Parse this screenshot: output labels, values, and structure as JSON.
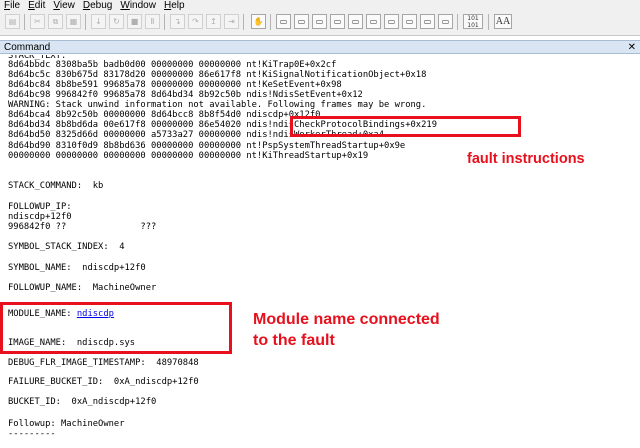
{
  "menu": [
    {
      "name": "file",
      "label": "File"
    },
    {
      "name": "edit",
      "label": "Edit"
    },
    {
      "name": "view",
      "label": "View"
    },
    {
      "name": "debug",
      "label": "Debug"
    },
    {
      "name": "window",
      "label": "Window"
    },
    {
      "name": "help",
      "label": "Help"
    }
  ],
  "toolbar_labels": {
    "hex": "101",
    "hex2": "101",
    "font": "AA"
  },
  "window_title": "Command",
  "lines": [
    {
      "t": "STACK_TEXT:"
    },
    {
      "t": "8d64bbdc 8308ba5b badb0d00 00000000 00000000 nt!KiTrap0E+0x2cf"
    },
    {
      "t": "8d64bc5c 830b675d 83178d20 00000000 86e617f8 nt!KiSignalNotificationObject+0x18"
    },
    {
      "t": "8d64bc84 8b8be591 99685a78 00000000 00000000 nt!KeSetEvent+0x98"
    },
    {
      "t": "8d64bc98 996842f0 99685a78 8d64bd34 8b92c50b ndis!NdisSetEvent+0x12"
    },
    {
      "t": "WARNING: Stack unwind information not available. Following frames may be wrong."
    },
    {
      "t": "8d64bca4 8b92c50b 00000000 8d64bcc8 8b8f54d0 ndiscdp+0x12f0"
    },
    {
      "t": "8d64bd34 8b8bd6da 00e617f8 00000000 86e54020 ndis!ndisCheckProtocolBindings+0x219"
    },
    {
      "t": "8d64bd50 8325d66d 00000000 a5733a27 00000000 ndis!ndisWorkerThread+0xa4"
    },
    {
      "t": "8d64bd90 8310f0d9 8b8bd636 00000000 00000000 nt!PspSystemThreadStartup+0x9e"
    },
    {
      "t": "00000000 00000000 00000000 00000000 00000000 nt!KiThreadStartup+0x19"
    },
    {
      "t": ""
    },
    {
      "t": ""
    },
    {
      "t": "STACK_COMMAND:  kb"
    },
    {
      "t": ""
    },
    {
      "t": "FOLLOWUP_IP:"
    },
    {
      "t": "ndiscdp+12f0"
    },
    {
      "t": "996842f0 ??              ???"
    },
    {
      "t": ""
    },
    {
      "t": "SYMBOL_STACK_INDEX:  4"
    },
    {
      "t": ""
    },
    {
      "t": "SYMBOL_NAME:  ndiscdp+12f0"
    },
    {
      "t": ""
    },
    {
      "t": "FOLLOWUP_NAME:  MachineOwner"
    },
    {
      "t": ""
    },
    {
      "t": "MODULE_NAME: ",
      "link": "ndiscdp"
    },
    {
      "t": ""
    },
    {
      "t": "IMAGE_NAME:  ndiscdp.sys"
    },
    {
      "t": ""
    },
    {
      "t": "DEBUG_FLR_IMAGE_TIMESTAMP:  48970848"
    },
    {
      "t": ""
    },
    {
      "t": "FAILURE_BUCKET_ID:  0xA_ndiscdp+12f0"
    },
    {
      "t": ""
    },
    {
      "t": "BUCKET_ID:  0xA_ndiscdp+12f0"
    },
    {
      "t": ""
    },
    {
      "t": "Followup: MachineOwner"
    },
    {
      "t": "---------"
    }
  ],
  "annotations": {
    "fault": "fault instructions",
    "module_line1": "Module name connected",
    "module_line2": "to the fault"
  },
  "colors": {
    "annotation": "#e8101d",
    "link": "#0000ee"
  }
}
